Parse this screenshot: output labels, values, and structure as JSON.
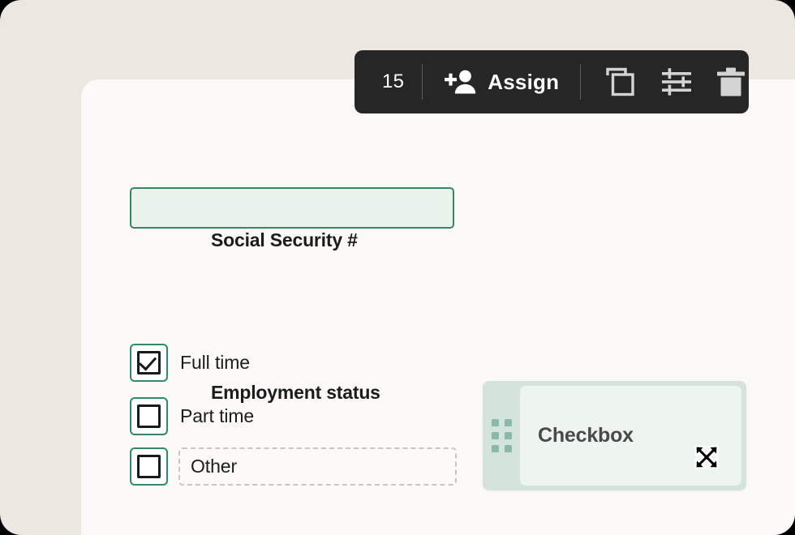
{
  "page": {
    "background_color": "#ece7e0",
    "card_color": "#fbfaf8",
    "accent_green": "#2e8b63",
    "accent_green_fill": "#eaf4ec",
    "toolbar_color": "#262626"
  },
  "toolbar": {
    "selection_count": "15",
    "assign_label": "Assign",
    "icons": [
      {
        "name": "person-add-icon",
        "label": "Assign"
      },
      {
        "name": "duplicate-icon",
        "label": "Duplicate"
      },
      {
        "name": "settings-sliders-icon",
        "label": "Settings"
      },
      {
        "name": "trash-icon",
        "label": "Delete"
      }
    ]
  },
  "form": {
    "ssn_field": {
      "label": "Social Security #",
      "value": "",
      "placeholder": ""
    },
    "employment": {
      "label": "Employment status",
      "options": [
        {
          "label": "Full time",
          "checked": true,
          "dashed": false
        },
        {
          "label": "Part time",
          "checked": false,
          "dashed": false
        },
        {
          "label": "Other",
          "checked": false,
          "dashed": true
        }
      ]
    }
  },
  "drag_card": {
    "title": "Checkbox",
    "handle_icon": "drag-handle-dots-icon",
    "cursor_icon": "move-cursor-icon",
    "strip_color": "#d4e3dc",
    "body_color": "#eef5f0",
    "dot_color": "#8ab8ab"
  }
}
